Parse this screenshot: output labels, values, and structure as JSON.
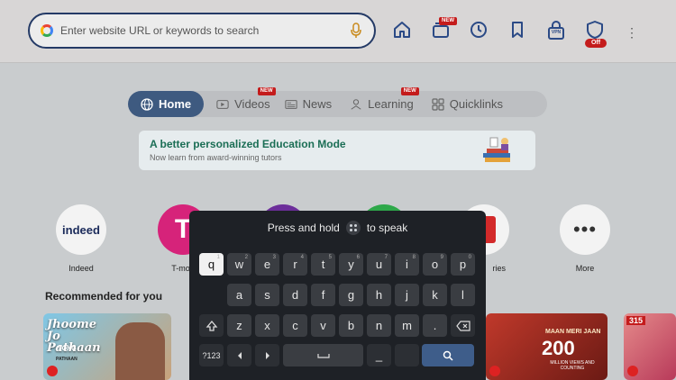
{
  "search": {
    "placeholder": "Enter website URL or keywords to search"
  },
  "toolbar": {
    "tabs_badge": "NEW",
    "vpn_label": "VPN",
    "shield_badge": "Off"
  },
  "tabs": [
    {
      "label": "Home",
      "active": true
    },
    {
      "label": "Videos",
      "badge": "NEW"
    },
    {
      "label": "News"
    },
    {
      "label": "Learning",
      "badge": "NEW"
    },
    {
      "label": "Quicklinks"
    }
  ],
  "banner": {
    "title": "A better personalized Education Mode",
    "subtitle": "Now learn from award-winning tutors"
  },
  "quicklinks": [
    {
      "label": "Indeed",
      "logo": "indeed"
    },
    {
      "label": "T-mob",
      "logo": "T"
    },
    {
      "label": "ries"
    },
    {
      "label": "More"
    }
  ],
  "recommended": {
    "title": "Recommended for you",
    "thumb1_title": "Jhoome Jo Pathaan",
    "thumb1_sub": "SONG",
    "thumb1_tag": "PATHAAN",
    "thumb2_title": "MAAN MERI JAAN",
    "thumb2_stat": "200",
    "thumb2_caption": "MILLION VIEWS AND COUNTING",
    "thumb3_tag": "315"
  },
  "keyboard": {
    "prompt_before": "Press and hold",
    "prompt_after": "to speak",
    "row1": [
      {
        "k": "q",
        "n": "1"
      },
      {
        "k": "w",
        "n": "2"
      },
      {
        "k": "e",
        "n": "3"
      },
      {
        "k": "r",
        "n": "4"
      },
      {
        "k": "t",
        "n": "5"
      },
      {
        "k": "y",
        "n": "6"
      },
      {
        "k": "u",
        "n": "7"
      },
      {
        "k": "i",
        "n": "8"
      },
      {
        "k": "o",
        "n": "9"
      },
      {
        "k": "p",
        "n": "0"
      }
    ],
    "row2": [
      "a",
      "s",
      "d",
      "f",
      "g",
      "h",
      "j",
      "k",
      "l"
    ],
    "row3": [
      "z",
      "x",
      "c",
      "v",
      "b",
      "n",
      "m",
      "."
    ],
    "symbols_key": "?123",
    "period_key": "_",
    "focused_key": "q"
  },
  "colors": {
    "accent": "#3e5a80",
    "badge_red": "#c41c1c",
    "banner_green": "#1b6e55"
  }
}
